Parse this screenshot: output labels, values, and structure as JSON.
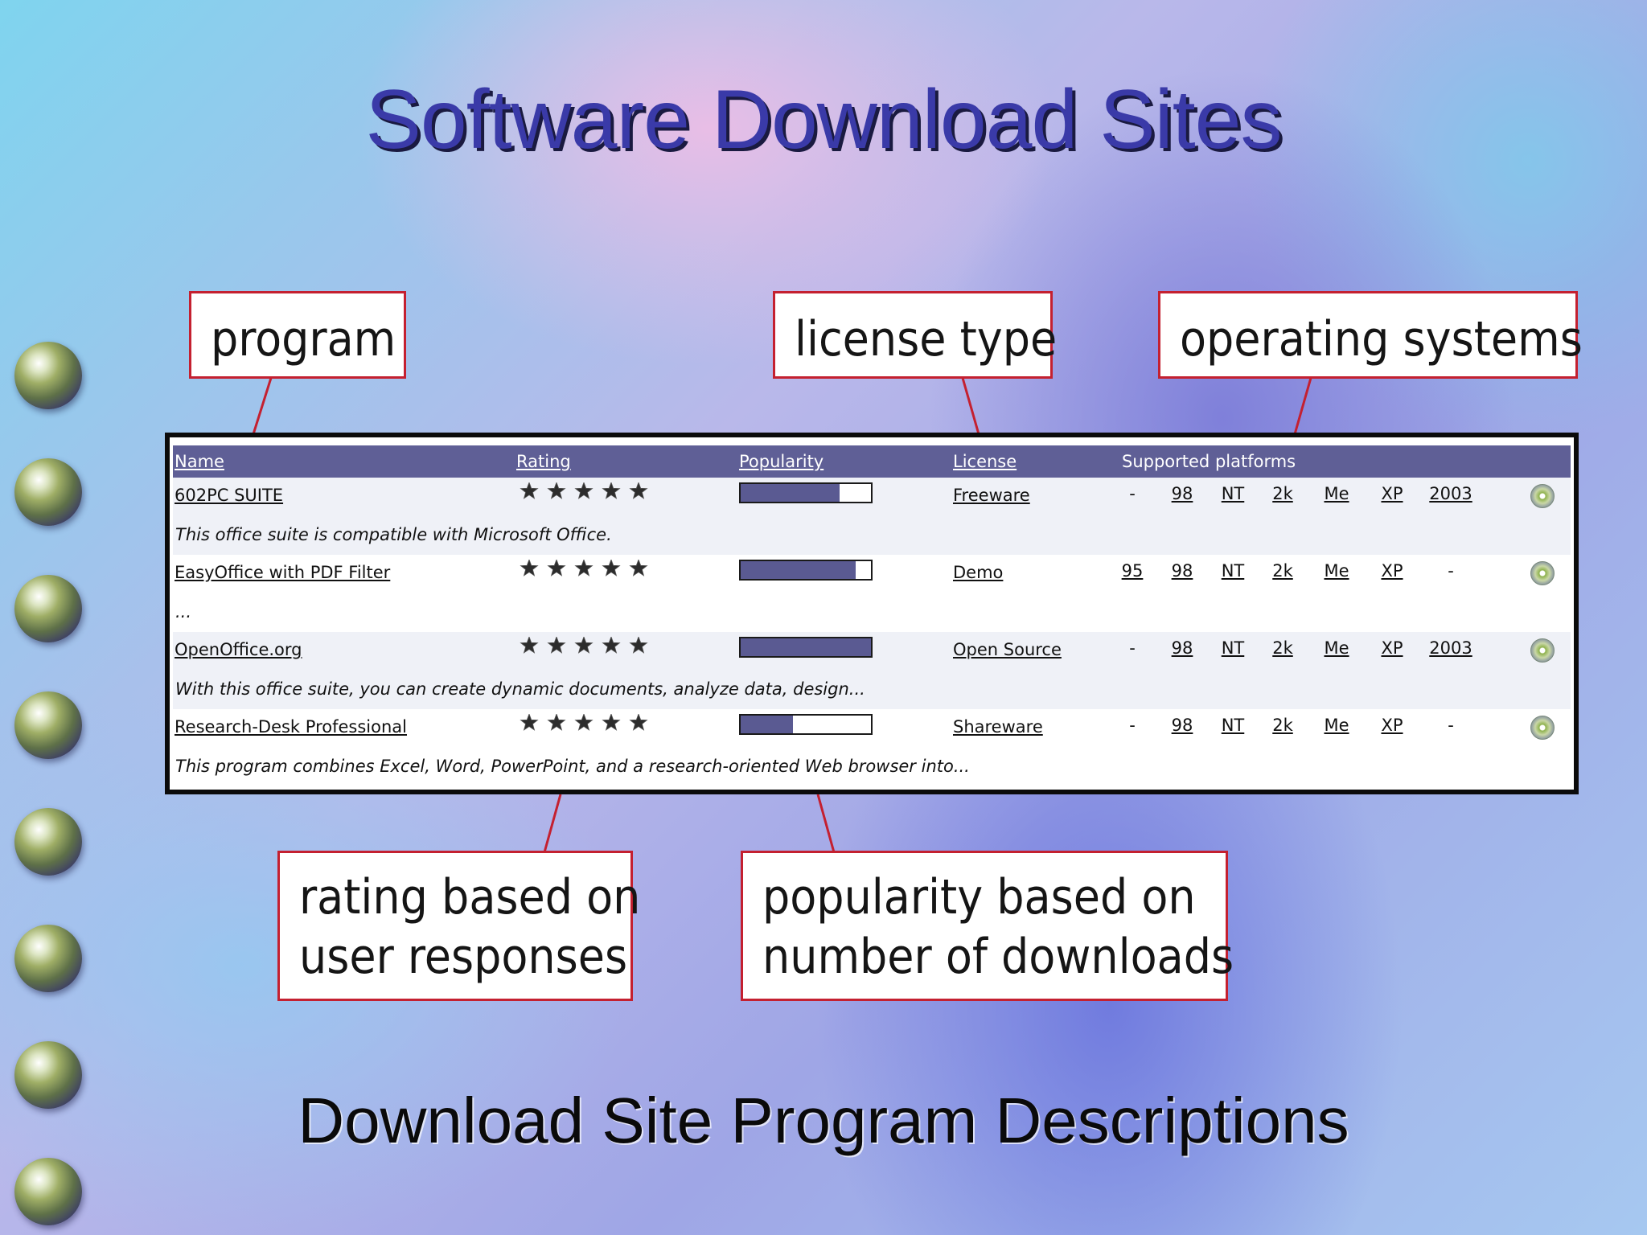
{
  "slide": {
    "title": "Software Download Sites",
    "subtitle": "Download Site Program Descriptions"
  },
  "callouts": {
    "program": "program",
    "license_type": "license type",
    "operating_systems": "operating systems",
    "rating_line1": "rating based on",
    "rating_line2": "user responses",
    "popularity_line1": "popularity based on",
    "popularity_line2": "number of downloads"
  },
  "table": {
    "header": {
      "name": "Name",
      "rating": "Rating",
      "popularity": "Popularity",
      "license": "License",
      "platforms": "Supported platforms"
    },
    "rows": [
      {
        "name": "602PC SUITE",
        "popularity": 0.76,
        "license": "Freeware",
        "platforms": [
          "-",
          "98",
          "NT",
          "2k",
          "Me",
          "XP",
          "2003"
        ],
        "description": "This office suite is compatible with Microsoft Office."
      },
      {
        "name": "EasyOffice with PDF Filter",
        "popularity": 0.88,
        "license": "Demo",
        "platforms": [
          "95",
          "98",
          "NT",
          "2k",
          "Me",
          "XP",
          "-"
        ],
        "description": "..."
      },
      {
        "name": "OpenOffice.org",
        "popularity": 1.0,
        "license": "Open Source",
        "platforms": [
          "-",
          "98",
          "NT",
          "2k",
          "Me",
          "XP",
          "2003"
        ],
        "description": "With this office suite, you can create dynamic documents, analyze data, design..."
      },
      {
        "name": "Research-Desk Professional",
        "popularity": 0.4,
        "license": "Shareware",
        "platforms": [
          "-",
          "98",
          "NT",
          "2k",
          "Me",
          "XP",
          "-"
        ],
        "description": "This program combines Excel, Word, PowerPoint, and a research-oriented Web browser into..."
      }
    ]
  },
  "colors": {
    "title": "#3a3aa8",
    "callout_border": "#c42030",
    "header_bg": "#5f5f96",
    "bar_fill": "#5a5a92"
  },
  "icons": {
    "bullet": "globe-bullet-icon",
    "download": "cd-download-icon",
    "rating": "star-rating-icon"
  }
}
